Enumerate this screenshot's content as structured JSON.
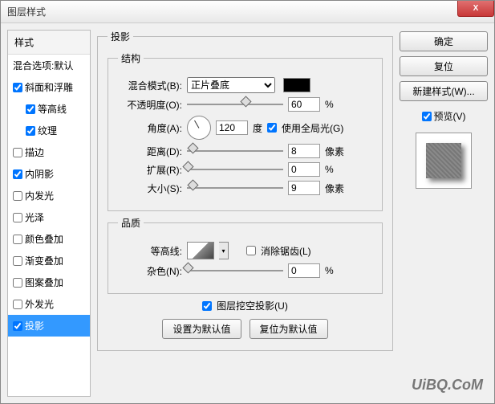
{
  "window": {
    "title": "图层样式",
    "close": "X"
  },
  "left": {
    "header": "样式",
    "blending": "混合选项:默认",
    "items": [
      {
        "label": "斜面和浮雕",
        "checked": true,
        "sub": false
      },
      {
        "label": "等高线",
        "checked": true,
        "sub": true
      },
      {
        "label": "纹理",
        "checked": true,
        "sub": true
      },
      {
        "label": "描边",
        "checked": false,
        "sub": false
      },
      {
        "label": "内阴影",
        "checked": true,
        "sub": false
      },
      {
        "label": "内发光",
        "checked": false,
        "sub": false
      },
      {
        "label": "光泽",
        "checked": false,
        "sub": false
      },
      {
        "label": "颜色叠加",
        "checked": false,
        "sub": false
      },
      {
        "label": "渐变叠加",
        "checked": false,
        "sub": false
      },
      {
        "label": "图案叠加",
        "checked": false,
        "sub": false
      },
      {
        "label": "外发光",
        "checked": false,
        "sub": false
      },
      {
        "label": "投影",
        "checked": true,
        "sub": false,
        "selected": true
      }
    ]
  },
  "center": {
    "group_title": "投影",
    "structure_title": "结构",
    "blend_mode_label": "混合模式(B):",
    "blend_mode_value": "正片叠底",
    "opacity_label": "不透明度(O):",
    "opacity_value": "60",
    "percent": "%",
    "angle_label": "角度(A):",
    "angle_value": "120",
    "angle_unit": "度",
    "global_light": "使用全局光(G)",
    "distance_label": "距离(D):",
    "distance_value": "8",
    "px": "像素",
    "spread_label": "扩展(R):",
    "spread_value": "0",
    "size_label": "大小(S):",
    "size_value": "9",
    "quality_title": "品质",
    "contour_label": "等高线:",
    "antialias": "消除锯齿(L)",
    "noise_label": "杂色(N):",
    "noise_value": "0",
    "knockout": "图层挖空投影(U)",
    "set_default": "设置为默认值",
    "reset_default": "复位为默认值"
  },
  "right": {
    "ok": "确定",
    "cancel": "复位",
    "new_style": "新建样式(W)...",
    "preview": "预览(V)"
  },
  "watermark": "UiBQ.CoM"
}
